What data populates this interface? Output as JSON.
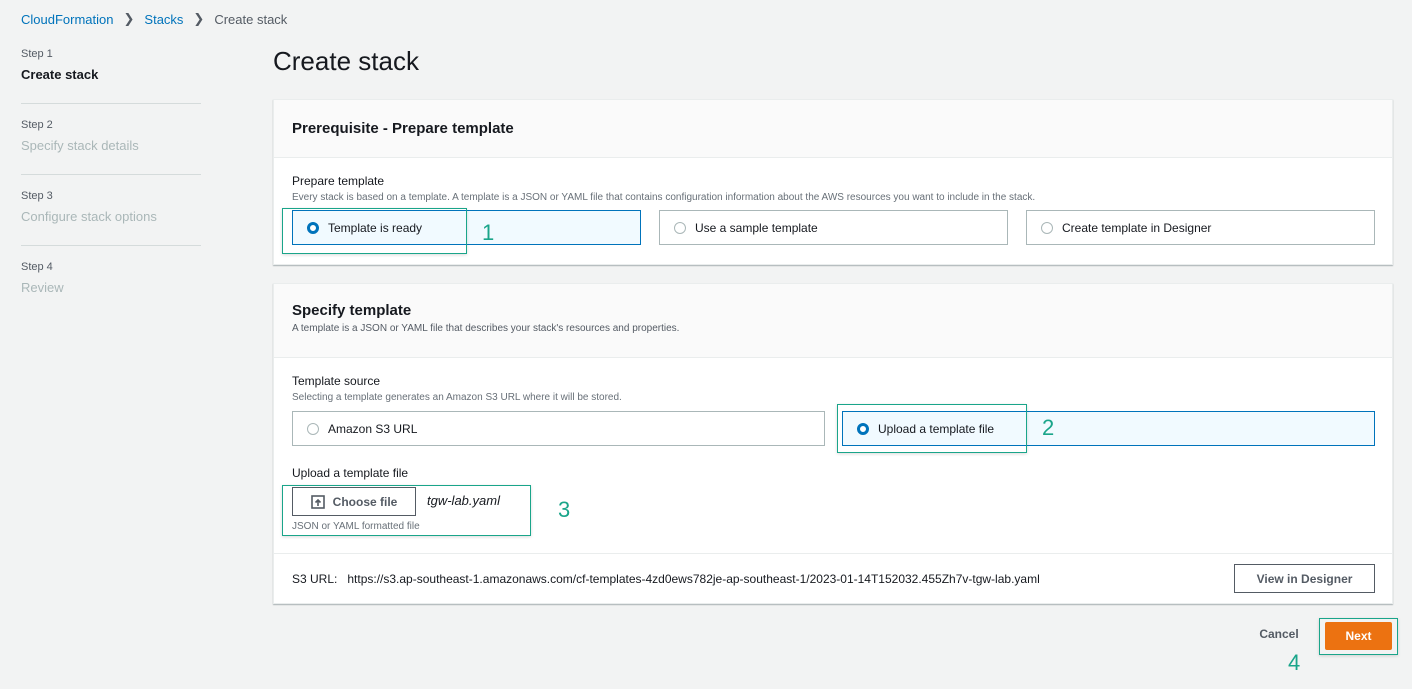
{
  "breadcrumb": {
    "items": [
      "CloudFormation",
      "Stacks"
    ],
    "current": "Create stack"
  },
  "steps": [
    {
      "number": "Step 1",
      "title": "Create stack",
      "active": true
    },
    {
      "number": "Step 2",
      "title": "Specify stack details",
      "active": false
    },
    {
      "number": "Step 3",
      "title": "Configure stack options",
      "active": false
    },
    {
      "number": "Step 4",
      "title": "Review",
      "active": false
    }
  ],
  "page_title": "Create stack",
  "prerequisite": {
    "title": "Prerequisite - Prepare template",
    "field_label": "Prepare template",
    "field_desc": "Every stack is based on a template. A template is a JSON or YAML file that contains configuration information about the AWS resources you want to include in the stack.",
    "options": [
      {
        "label": "Template is ready",
        "selected": true
      },
      {
        "label": "Use a sample template",
        "selected": false
      },
      {
        "label": "Create template in Designer",
        "selected": false
      }
    ]
  },
  "specify": {
    "title": "Specify template",
    "desc": "A template is a JSON or YAML file that describes your stack's resources and properties.",
    "source_label": "Template source",
    "source_desc": "Selecting a template generates an Amazon S3 URL where it will be stored.",
    "options": [
      {
        "label": "Amazon S3 URL",
        "selected": false
      },
      {
        "label": "Upload a template file",
        "selected": true
      }
    ],
    "upload_label": "Upload a template file",
    "choose_file": "Choose file",
    "file_name": "tgw-lab.yaml",
    "file_constraint": "JSON or YAML formatted file",
    "s3_label": "S3 URL:",
    "s3_url": "https://s3.ap-southeast-1.amazonaws.com/cf-templates-4zd0ews782je-ap-southeast-1/2023-01-14T152032.455Zh7v-tgw-lab.yaml",
    "view_designer": "View in Designer"
  },
  "footer": {
    "cancel": "Cancel",
    "next": "Next"
  },
  "annotations": [
    "1",
    "2",
    "3",
    "4"
  ],
  "colors": {
    "link": "#0073bb",
    "primary": "#ec7211",
    "annotation": "#1aa58a"
  }
}
